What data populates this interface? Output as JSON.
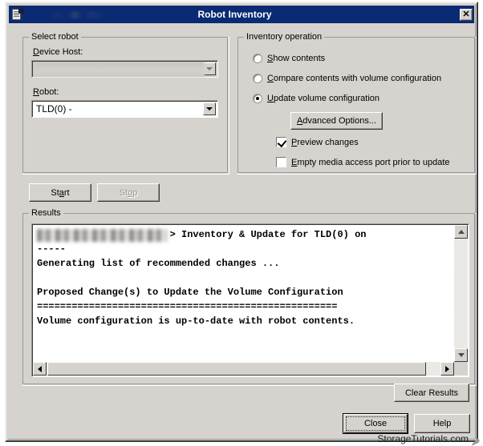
{
  "window": {
    "title": "Robot Inventory",
    "icon": "document-icon",
    "close_label": "✕",
    "bg_color": "#d6d3ce",
    "titlebar_color": "#0a2a74"
  },
  "select_robot": {
    "legend": "Select robot",
    "device_host": {
      "label": "Device Host:",
      "label_accel": "D",
      "value": "",
      "placeholder": "",
      "disabled": true
    },
    "robot": {
      "label": "Robot:",
      "label_accel": "R",
      "value": "TLD(0) - ",
      "options": [
        "TLD(0) - "
      ]
    }
  },
  "inventory_operation": {
    "legend": "Inventory operation",
    "options": [
      {
        "label": "Show contents",
        "accel": "S",
        "selected": false
      },
      {
        "label": "Compare contents with volume configuration",
        "accel": "C",
        "selected": false
      },
      {
        "label": "Update volume configuration",
        "accel": "U",
        "selected": true
      }
    ],
    "advanced_button": {
      "label": "Advanced Options...",
      "accel": "A"
    },
    "checkboxes": [
      {
        "label": "Preview changes",
        "accel": "P",
        "checked": true
      },
      {
        "label": "Empty media access port prior to update",
        "accel": "E",
        "checked": false
      }
    ]
  },
  "actions": {
    "start": {
      "label": "Start",
      "accel": "a",
      "disabled": false
    },
    "stop": {
      "label": "Stop",
      "accel": "o",
      "disabled": true
    }
  },
  "results": {
    "legend": "Results",
    "redacted_host": true,
    "lines": [
      "                       > Inventory & Update for TLD(0) on",
      "-----",
      "Generating list of recommended changes ...",
      "",
      "Proposed Change(s) to Update the Volume Configuration",
      "====================================================",
      "Volume configuration is up-to-date with robot contents."
    ],
    "text": "                       > Inventory & Update for TLD(0) on\n-----\nGenerating list of recommended changes ...\n\nProposed Change(s) to Update the Volume Configuration\n====================================================\nVolume configuration is up-to-date with robot contents.",
    "clear_button": "Clear Results",
    "vscroll": {
      "up": "▲",
      "down": "▼"
    },
    "hscroll": {
      "left": "◀",
      "right": "▶"
    }
  },
  "footer": {
    "close": "Close",
    "help": "Help",
    "watermark": "StorageTutorials.com"
  }
}
